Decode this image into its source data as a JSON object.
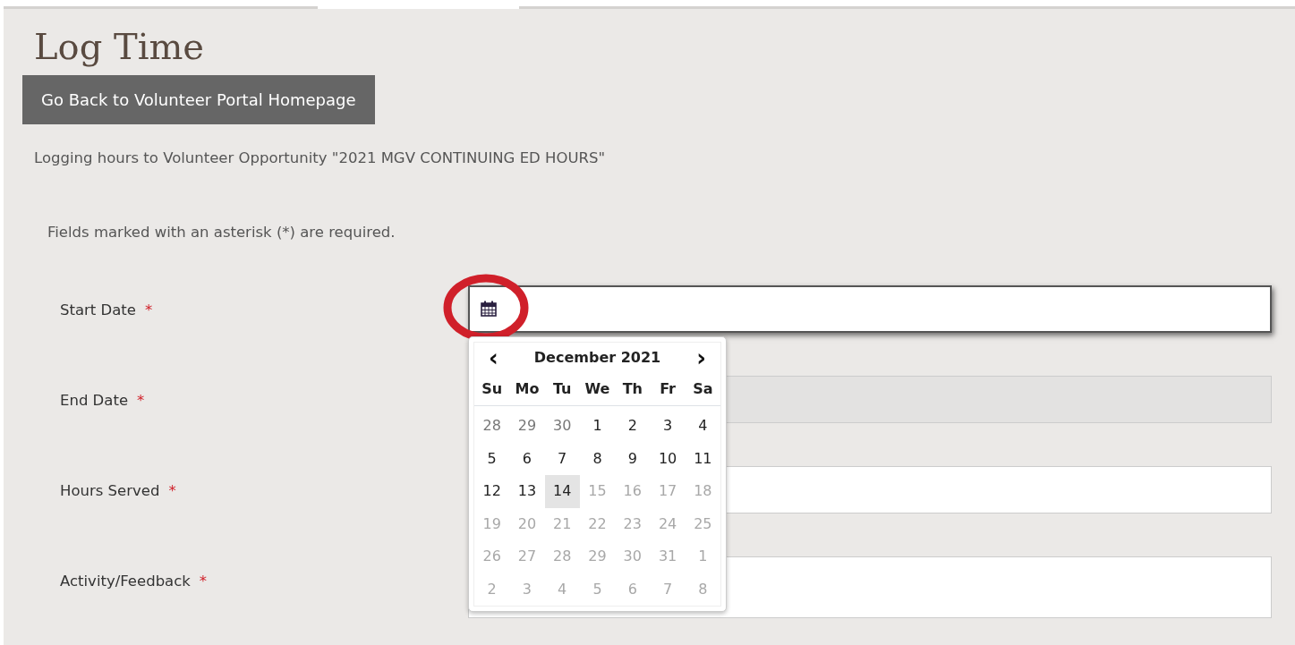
{
  "title": "Log Time",
  "back_button": "Go Back to Volunteer Portal Homepage",
  "description": "Logging hours to Volunteer Opportunity \"2021 MGV CONTINUING ED HOURS\"",
  "required_note": "Fields marked with an asterisk (*) are required.",
  "fields": [
    {
      "label": "Start Date",
      "required_mark": "*",
      "kind": "date",
      "focused": true,
      "disabled": false
    },
    {
      "label": "End Date",
      "required_mark": "*",
      "kind": "text",
      "focused": false,
      "disabled": true
    },
    {
      "label": "Hours Served",
      "required_mark": "*",
      "kind": "text",
      "focused": false,
      "disabled": false
    },
    {
      "label": "Activity/Feedback",
      "required_mark": "*",
      "kind": "textarea",
      "focused": false,
      "disabled": false
    }
  ],
  "annotation": {
    "kind": "ellipse",
    "color": "#d0202a"
  },
  "datepicker": {
    "prev": "‹",
    "month": "December 2021",
    "next": "›",
    "weekdays": [
      "Su",
      "Mo",
      "Tu",
      "We",
      "Th",
      "Fr",
      "Sa"
    ],
    "weeks": [
      [
        {
          "day": "28",
          "kind": "muted",
          "selected": false
        },
        {
          "day": "29",
          "kind": "muted",
          "selected": false
        },
        {
          "day": "30",
          "kind": "muted",
          "selected": false
        },
        {
          "day": "1",
          "kind": "normal",
          "selected": false
        },
        {
          "day": "2",
          "kind": "normal",
          "selected": false
        },
        {
          "day": "3",
          "kind": "normal",
          "selected": false
        },
        {
          "day": "4",
          "kind": "normal",
          "selected": false
        }
      ],
      [
        {
          "day": "5",
          "kind": "normal",
          "selected": false
        },
        {
          "day": "6",
          "kind": "normal",
          "selected": false
        },
        {
          "day": "7",
          "kind": "normal",
          "selected": false
        },
        {
          "day": "8",
          "kind": "normal",
          "selected": false
        },
        {
          "day": "9",
          "kind": "normal",
          "selected": false
        },
        {
          "day": "10",
          "kind": "normal",
          "selected": false
        },
        {
          "day": "11",
          "kind": "normal",
          "selected": false
        }
      ],
      [
        {
          "day": "12",
          "kind": "normal",
          "selected": false
        },
        {
          "day": "13",
          "kind": "normal",
          "selected": false
        },
        {
          "day": "14",
          "kind": "normal",
          "selected": true
        },
        {
          "day": "15",
          "kind": "disabled",
          "selected": false
        },
        {
          "day": "16",
          "kind": "disabled",
          "selected": false
        },
        {
          "day": "17",
          "kind": "disabled",
          "selected": false
        },
        {
          "day": "18",
          "kind": "disabled",
          "selected": false
        }
      ],
      [
        {
          "day": "19",
          "kind": "disabled",
          "selected": false
        },
        {
          "day": "20",
          "kind": "disabled",
          "selected": false
        },
        {
          "day": "21",
          "kind": "disabled",
          "selected": false
        },
        {
          "day": "22",
          "kind": "disabled",
          "selected": false
        },
        {
          "day": "23",
          "kind": "disabled",
          "selected": false
        },
        {
          "day": "24",
          "kind": "disabled",
          "selected": false
        },
        {
          "day": "25",
          "kind": "disabled",
          "selected": false
        }
      ],
      [
        {
          "day": "26",
          "kind": "disabled",
          "selected": false
        },
        {
          "day": "27",
          "kind": "disabled",
          "selected": false
        },
        {
          "day": "28",
          "kind": "disabled",
          "selected": false
        },
        {
          "day": "29",
          "kind": "disabled",
          "selected": false
        },
        {
          "day": "30",
          "kind": "disabled",
          "selected": false
        },
        {
          "day": "31",
          "kind": "disabled",
          "selected": false
        },
        {
          "day": "1",
          "kind": "disabled",
          "selected": false
        }
      ],
      [
        {
          "day": "2",
          "kind": "disabled",
          "selected": false
        },
        {
          "day": "3",
          "kind": "disabled",
          "selected": false
        },
        {
          "day": "4",
          "kind": "disabled",
          "selected": false
        },
        {
          "day": "5",
          "kind": "disabled",
          "selected": false
        },
        {
          "day": "6",
          "kind": "disabled",
          "selected": false
        },
        {
          "day": "7",
          "kind": "disabled",
          "selected": false
        },
        {
          "day": "8",
          "kind": "disabled",
          "selected": false
        }
      ]
    ]
  }
}
